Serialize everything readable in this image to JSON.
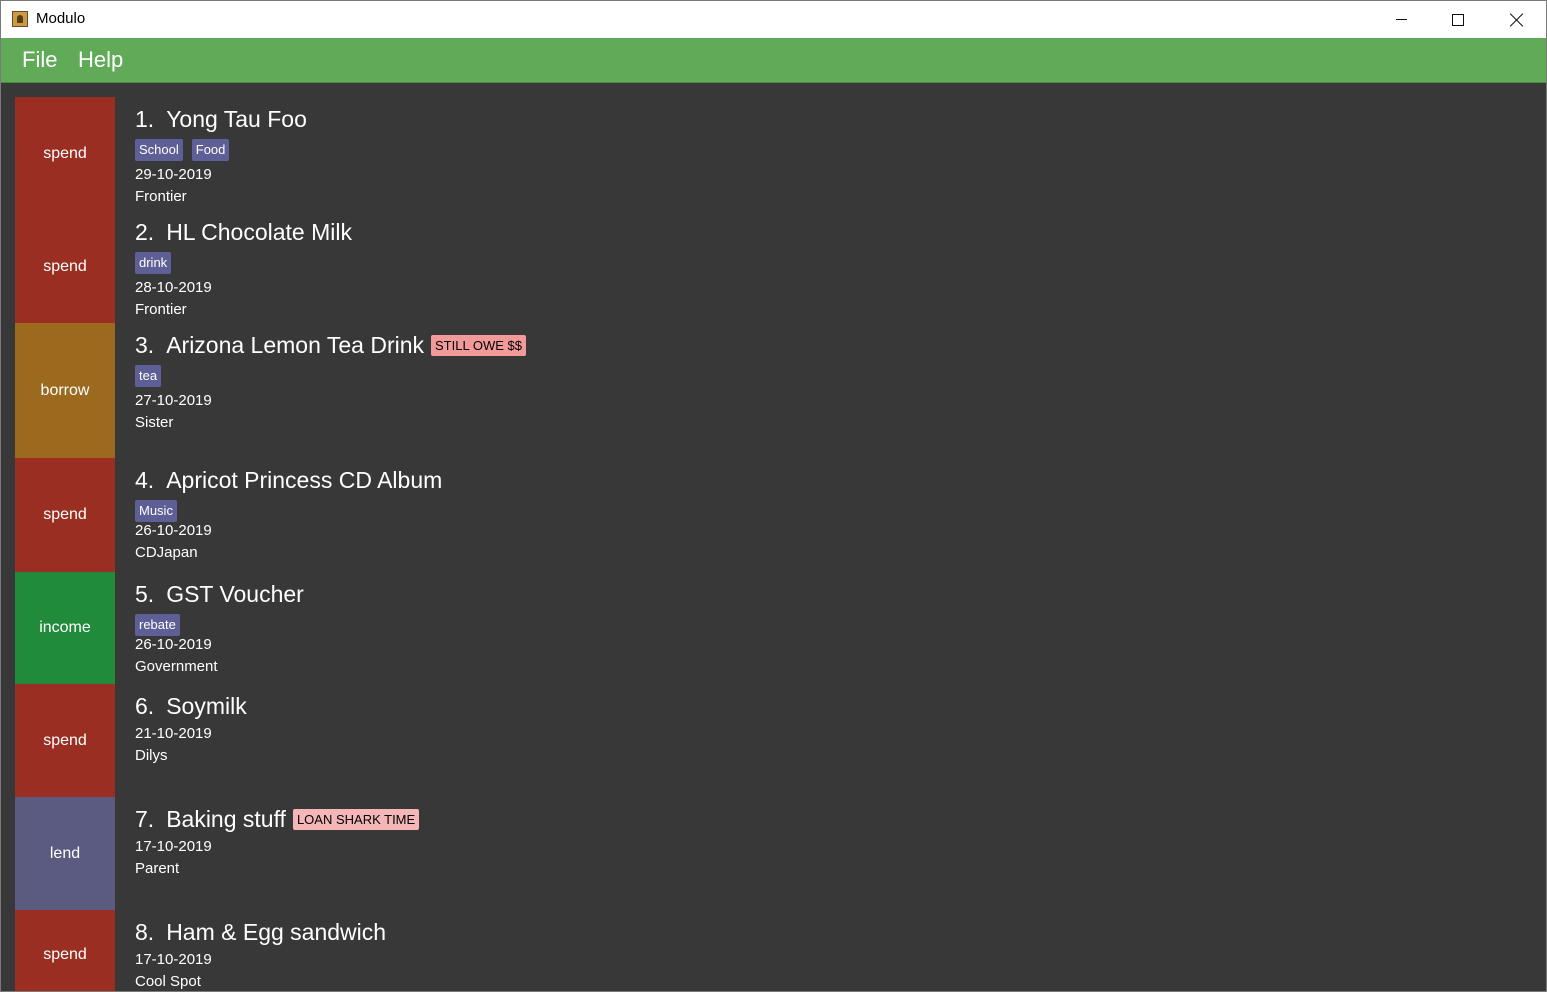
{
  "window": {
    "title": "Modulo",
    "controls": {
      "minimize": "minimize",
      "maximize": "maximize",
      "close": "close"
    }
  },
  "menu": {
    "file": "File",
    "help": "Help"
  },
  "colors": {
    "spend": "#9a2e22",
    "borrow": "#9b6a1f",
    "income": "#1f8b3b",
    "lend": "#5b5b82",
    "tag": "#5f5f98",
    "remark_red": "#f29a9a",
    "remark_pink": "#f4b6b6",
    "menubar": "#61ab58"
  },
  "entries": [
    {
      "type": "spend",
      "index": "1.",
      "name": "Yong Tau Foo",
      "tags": [
        "School",
        "Food"
      ],
      "date": "29-10-2019",
      "place": "Frontier",
      "remark": ""
    },
    {
      "type": "spend",
      "index": "2.",
      "name": "HL Chocolate Milk",
      "tags": [
        "drink"
      ],
      "date": "28-10-2019",
      "place": "Frontier",
      "remark": ""
    },
    {
      "type": "borrow",
      "index": "3.",
      "name": "Arizona Lemon Tea Drink",
      "tags": [
        "tea"
      ],
      "date": "27-10-2019",
      "place": "Sister",
      "remark": "STILL OWE $$"
    },
    {
      "type": "spend",
      "index": "4.",
      "name": "Apricot Princess CD Album",
      "tags": [
        "Music"
      ],
      "date": "26-10-2019",
      "place": "CDJapan",
      "remark": ""
    },
    {
      "type": "income",
      "index": "5.",
      "name": "GST Voucher",
      "tags": [
        "rebate"
      ],
      "date": "26-10-2019",
      "place": "Government",
      "remark": ""
    },
    {
      "type": "spend",
      "index": "6.",
      "name": "Soymilk",
      "tags": [],
      "date": "21-10-2019",
      "place": "Dilys",
      "remark": ""
    },
    {
      "type": "lend",
      "index": "7.",
      "name": "Baking stuff",
      "tags": [],
      "date": "17-10-2019",
      "place": "Parent",
      "remark": "LOAN SHARK TIME"
    },
    {
      "type": "spend",
      "index": "8.",
      "name": "Ham & Egg sandwich",
      "tags": [],
      "date": "17-10-2019",
      "place": "Cool Spot",
      "remark": ""
    }
  ]
}
